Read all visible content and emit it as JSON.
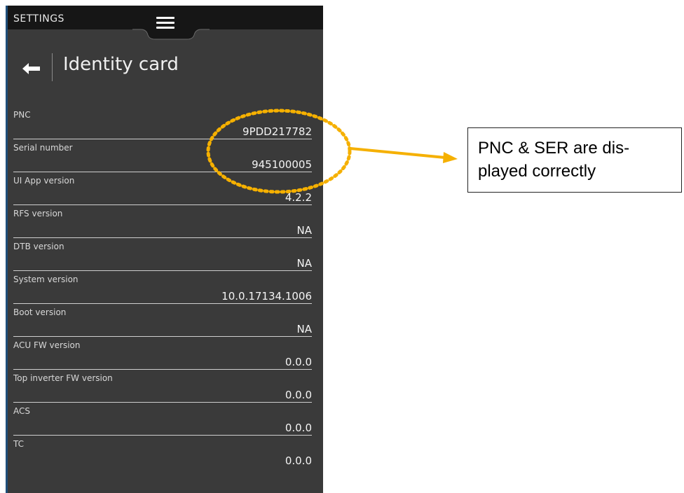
{
  "topbar": {
    "title": "SETTINGS",
    "menu_icon": "hamburger-menu-icon"
  },
  "header": {
    "back_icon": "arrow-left-icon",
    "title": "Identity card"
  },
  "rows": [
    {
      "label": "PNC",
      "value": "9PDD217782"
    },
    {
      "label": "Serial number",
      "value": "945100005"
    },
    {
      "label": "UI App version",
      "value": "4.2.2"
    },
    {
      "label": "RFS version",
      "value": "NA"
    },
    {
      "label": "DTB version",
      "value": "NA"
    },
    {
      "label": "System version",
      "value": "10.0.17134.1006"
    },
    {
      "label": "Boot version",
      "value": "NA"
    },
    {
      "label": "ACU FW version",
      "value": "0.0.0"
    },
    {
      "label": "Top inverter FW version",
      "value": "0.0.0"
    },
    {
      "label": "ACS",
      "value": "0.0.0"
    },
    {
      "label": "TC",
      "value": "0.0.0"
    }
  ],
  "annotation": {
    "line1": "PNC & SER are dis-",
    "line2": "played correctly",
    "highlight_color": "#F5B000"
  },
  "colors": {
    "panel_bg": "#3a3a3a",
    "topbar_bg": "#161616",
    "text": "#f0f0f0",
    "accent_border": "#1f4e79"
  }
}
